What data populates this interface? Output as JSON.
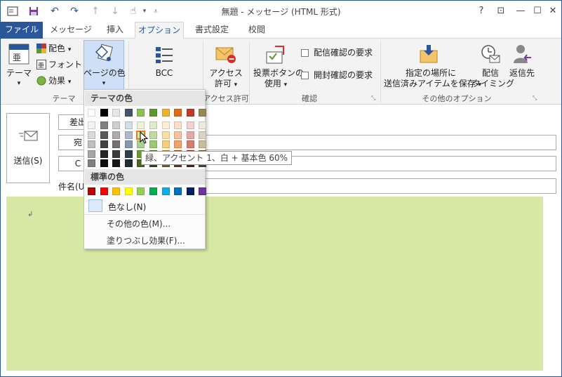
{
  "window": {
    "title": "無題 - メッセージ (HTML 形式)",
    "controls": {
      "help": "?",
      "restore_ribbon": "⊡",
      "minimize": "—",
      "maximize": "☐",
      "close": "✕"
    }
  },
  "tabs": [
    "ファイル",
    "メッセージ",
    "挿入",
    "オプション",
    "書式設定",
    "校閲"
  ],
  "ribbon": {
    "theme_group": {
      "label": "テーマ",
      "theme_button": "テーマ",
      "colors": "配色",
      "fonts": "フォント",
      "effects": "効果",
      "page_color": "ページの色"
    },
    "bcc_group": {
      "bcc": "BCC"
    },
    "permission_group": {
      "label": "アクセス許可",
      "button_line1": "アクセス",
      "button_line2": "許可"
    },
    "tracking_group": {
      "label": "確認",
      "voting_line1": "投票ボタンの",
      "voting_line2": "使用",
      "delivery_receipt": "配信確認の要求",
      "read_receipt": "開封確認の要求"
    },
    "more_group": {
      "label": "その他のオプション",
      "save_line1": "指定の場所に",
      "save_line2": "送信済みアイテムを保存",
      "delay_line1": "配信",
      "delay_line2": "タイミング",
      "reply": "返信先"
    }
  },
  "compose": {
    "send": "送信(S)",
    "from": "差出",
    "to": "宛",
    "cc": "C",
    "subject": "件名(U)",
    "body_mark": "↲"
  },
  "dropdown": {
    "theme_colors_header": "テーマの色",
    "standard_colors_header": "標準の色",
    "no_color": "色なし(N)",
    "more_colors": "その他の色(M)...",
    "fill_effects": "塗りつぶし効果(F)...",
    "tooltip": "緑、アクセント 1、白 + 基本色 60%",
    "theme_top_row": [
      "#ffffff",
      "#000000",
      "#e7e6e6",
      "#44546a",
      "#8bc34a",
      "#5b9a2a",
      "#f0b323",
      "#e0691a",
      "#c0392b",
      "#948a54"
    ],
    "theme_shades": [
      [
        "#f2f2f2",
        "#808080",
        "#d0cece",
        "#d6dce4",
        "#e8f3d9",
        "#dcebc9",
        "#fcefd1",
        "#fbe0c9",
        "#f2d3cf",
        "#ede9dd"
      ],
      [
        "#d9d9d9",
        "#595959",
        "#afabab",
        "#adb9ca",
        "#d6e8a4",
        "#bedc9b",
        "#f9dfa3",
        "#f7c19c",
        "#e6a8a0",
        "#dbd3bb"
      ],
      [
        "#bfbfbf",
        "#404040",
        "#767171",
        "#8497b0",
        "#a9d18e",
        "#9ccb6e",
        "#f6cf75",
        "#f3a26e",
        "#d97c70",
        "#c9bd99"
      ],
      [
        "#a6a6a6",
        "#262626",
        "#3a3838",
        "#323f4f",
        "#6a9b2f",
        "#46731f",
        "#b3861a",
        "#a74e13",
        "#902b20",
        "#6f673e"
      ],
      [
        "#7f7f7f",
        "#0d0d0d",
        "#171616",
        "#222a35",
        "#466620",
        "#2e4c15",
        "#775911",
        "#6f340c",
        "#601d15",
        "#4a452a"
      ]
    ],
    "standard_colors": [
      "#c00000",
      "#ff0000",
      "#ffc000",
      "#ffff00",
      "#92d050",
      "#00b050",
      "#00b0f0",
      "#0070c0",
      "#002060",
      "#7030a0"
    ]
  }
}
